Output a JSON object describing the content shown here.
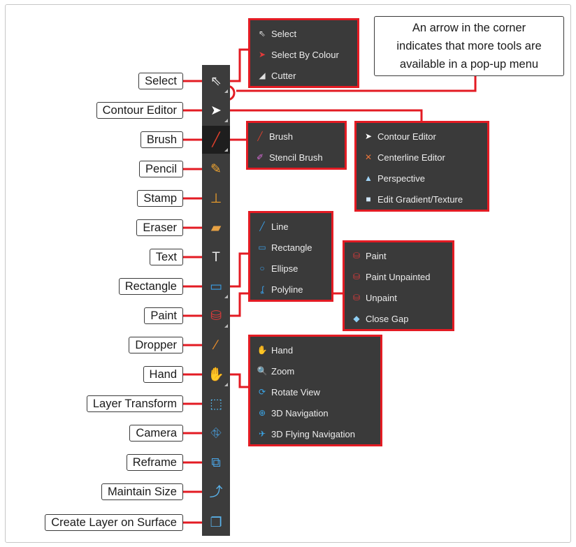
{
  "callout": {
    "lines": [
      "An arrow in the corner",
      "indicates that more tools are",
      "available in a pop-up menu"
    ]
  },
  "tools": [
    {
      "label": "Select",
      "icon": "select-arrow-icon",
      "glyph": "⇖",
      "color": "#e8e8e8",
      "more": true
    },
    {
      "label": "Contour Editor",
      "icon": "contour-editor-icon",
      "glyph": "➤",
      "color": "#ffffff",
      "more": true
    },
    {
      "label": "Brush",
      "icon": "brush-icon",
      "glyph": "╱",
      "color": "#e0412d",
      "more": true,
      "active": true
    },
    {
      "label": "Pencil",
      "icon": "pencil-icon",
      "glyph": "✎",
      "color": "#f0a531",
      "more": false
    },
    {
      "label": "Stamp",
      "icon": "stamp-icon",
      "glyph": "⊥",
      "color": "#f2a12a",
      "more": false
    },
    {
      "label": "Eraser",
      "icon": "eraser-icon",
      "glyph": "▰",
      "color": "#e6a144",
      "more": false
    },
    {
      "label": "Text",
      "icon": "text-icon",
      "glyph": "T",
      "color": "#e8e8e8",
      "more": false
    },
    {
      "label": "Rectangle",
      "icon": "rectangle-icon",
      "glyph": "▭",
      "color": "#3a9ee6",
      "more": true
    },
    {
      "label": "Paint",
      "icon": "paint-bucket-icon",
      "glyph": "⛁",
      "color": "#e23a3a",
      "more": true
    },
    {
      "label": "Dropper",
      "icon": "dropper-icon",
      "glyph": "⁄",
      "color": "#f0902a",
      "more": false
    },
    {
      "label": "Hand",
      "icon": "hand-icon",
      "glyph": "✋",
      "color": "#f2f2f2",
      "more": true
    },
    {
      "label": "Layer Transform",
      "icon": "layer-transform-icon",
      "glyph": "⬚",
      "color": "#55b8ee",
      "more": false
    },
    {
      "label": "Camera",
      "icon": "camera-icon",
      "glyph": "⛗",
      "color": "#4aa6e8",
      "more": false
    },
    {
      "label": "Reframe",
      "icon": "reframe-icon",
      "glyph": "⧉",
      "color": "#4aa6e8",
      "more": false
    },
    {
      "label": "Maintain Size",
      "icon": "maintain-size-icon",
      "glyph": "⤴",
      "color": "#5ab5ee",
      "more": false
    },
    {
      "label": "Create Layer on Surface",
      "icon": "create-layer-on-surface-icon",
      "glyph": "❐",
      "color": "#5ab5ee",
      "more": false
    }
  ],
  "menus": {
    "select": [
      {
        "label": "Select",
        "icon": "select-arrow-icon",
        "glyph": "⇖",
        "color": "#e0e0e0"
      },
      {
        "label": "Select By Colour",
        "icon": "select-by-colour-icon",
        "glyph": "➤",
        "color": "#e23a3a"
      },
      {
        "label": "Cutter",
        "icon": "cutter-icon",
        "glyph": "◢",
        "color": "#e0e0e0"
      }
    ],
    "brush": [
      {
        "label": "Brush",
        "icon": "brush-icon",
        "glyph": "╱",
        "color": "#e0412d"
      },
      {
        "label": "Stencil Brush",
        "icon": "stencil-brush-icon",
        "glyph": "✐",
        "color": "#d86bd8"
      }
    ],
    "contour": [
      {
        "label": "Contour Editor",
        "icon": "contour-editor-icon",
        "glyph": "➤",
        "color": "#ffffff"
      },
      {
        "label": "Centerline Editor",
        "icon": "centerline-editor-icon",
        "glyph": "✕",
        "color": "#e8743a"
      },
      {
        "label": "Perspective",
        "icon": "perspective-icon",
        "glyph": "▲",
        "color": "#9fd3f5"
      },
      {
        "label": "Edit Gradient/Texture",
        "icon": "edit-gradient-texture-icon",
        "glyph": "■",
        "color": "#cfe6f7"
      }
    ],
    "rectangle": [
      {
        "label": "Line",
        "icon": "line-icon",
        "glyph": "╱",
        "color": "#3a9ee6"
      },
      {
        "label": "Rectangle",
        "icon": "rectangle-icon",
        "glyph": "▭",
        "color": "#3a9ee6"
      },
      {
        "label": "Ellipse",
        "icon": "ellipse-icon",
        "glyph": "○",
        "color": "#3a9ee6"
      },
      {
        "label": "Polyline",
        "icon": "polyline-icon",
        "glyph": "ʆ",
        "color": "#3a9ee6"
      }
    ],
    "paint": [
      {
        "label": "Paint",
        "icon": "paint-bucket-icon",
        "glyph": "⛁",
        "color": "#e23a3a"
      },
      {
        "label": "Paint Unpainted",
        "icon": "paint-unpainted-icon",
        "glyph": "⛁",
        "color": "#e23a3a"
      },
      {
        "label": "Unpaint",
        "icon": "unpaint-icon",
        "glyph": "⛁",
        "color": "#e23a3a"
      },
      {
        "label": "Close Gap",
        "icon": "close-gap-icon",
        "glyph": "◆",
        "color": "#8fd0f5"
      }
    ],
    "hand": [
      {
        "label": "Hand",
        "icon": "hand-icon",
        "glyph": "✋",
        "color": "#f2f2f2"
      },
      {
        "label": "Zoom",
        "icon": "zoom-icon",
        "glyph": "🔍",
        "color": "#8fd0f5"
      },
      {
        "label": "Rotate View",
        "icon": "rotate-view-icon",
        "glyph": "⟳",
        "color": "#3aa6e8"
      },
      {
        "label": "3D Navigation",
        "icon": "3d-navigation-icon",
        "glyph": "⊕",
        "color": "#3aa6e8"
      },
      {
        "label": "3D Flying Navigation",
        "icon": "3d-flying-navigation-icon",
        "glyph": "✈",
        "color": "#3aa6e8"
      }
    ]
  },
  "colors": {
    "accent": "#e31b23",
    "panel": "#3c3c3c",
    "menu": "#3a3a3a"
  }
}
